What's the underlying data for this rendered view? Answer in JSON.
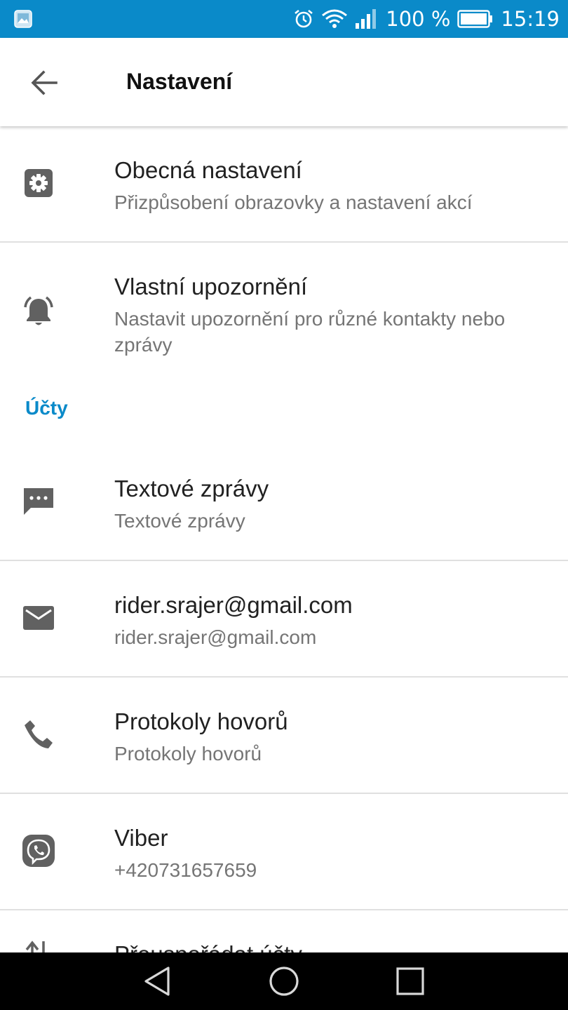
{
  "status_bar": {
    "battery_text": "100 %",
    "time": "15:19",
    "icons": [
      "gallery-icon",
      "alarm-icon",
      "wifi-icon",
      "signal-icon",
      "battery-icon"
    ]
  },
  "app_bar": {
    "title": "Nastavení",
    "back_icon": "arrow-back-icon"
  },
  "settings": [
    {
      "title": "Obecná nastavení",
      "subtitle": "Přizpůsobení obrazovky a nastavení akcí",
      "icon": "gear-icon"
    },
    {
      "title": "Vlastní upozornění",
      "subtitle": "Nastavit upozornění pro různé kontakty nebo zprávy",
      "icon": "bell-icon"
    }
  ],
  "accounts_section": {
    "header": "Účty",
    "items": [
      {
        "title": "Textové zprávy",
        "subtitle": "Textové zprávy",
        "icon": "message-icon"
      },
      {
        "title": "rider.srajer@gmail.com",
        "subtitle": "rider.srajer@gmail.com",
        "icon": "mail-icon"
      },
      {
        "title": "Protokoly hovorů",
        "subtitle": "Protokoly hovorů",
        "icon": "phone-icon"
      },
      {
        "title": "Viber",
        "subtitle": "+420731657659",
        "icon": "viber-icon"
      },
      {
        "title": "Přeuspořádat účty",
        "icon": "reorder-icon"
      }
    ]
  },
  "nav_bar": {
    "icons": [
      "back-triangle-icon",
      "home-circle-icon",
      "recents-square-icon"
    ]
  },
  "colors": {
    "accent": "#0a8ac9",
    "icon_gray": "#616161",
    "subtitle_gray": "#757575"
  }
}
